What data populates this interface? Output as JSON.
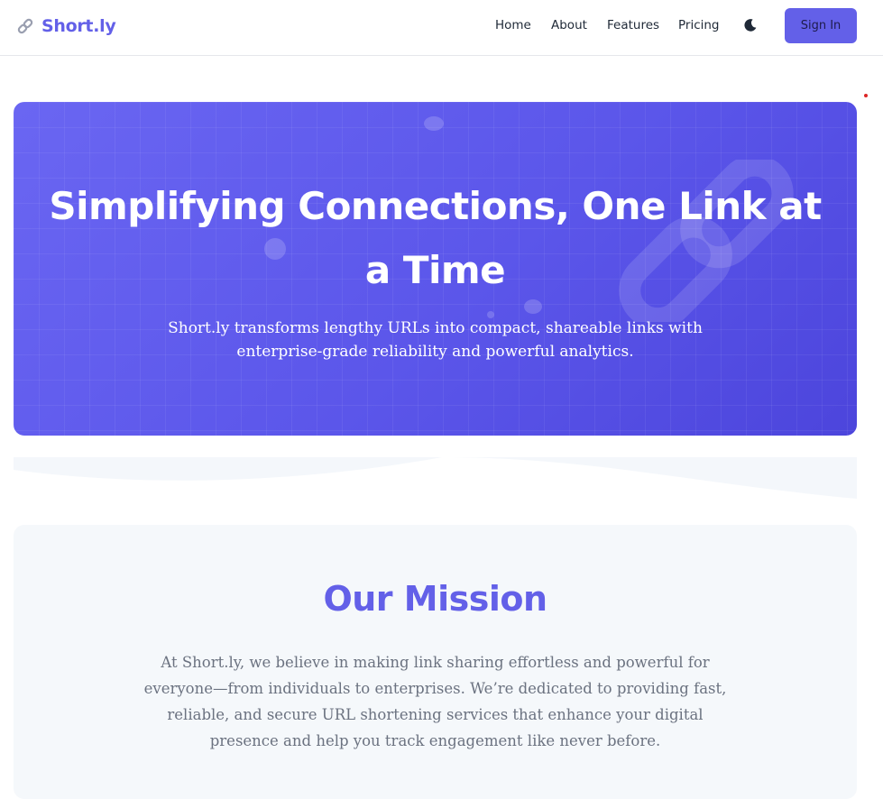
{
  "header": {
    "brand": {
      "icon": "link-icon",
      "name": "Short.ly"
    },
    "nav": [
      {
        "label": "Home"
      },
      {
        "label": "About"
      },
      {
        "label": "Features"
      },
      {
        "label": "Pricing"
      }
    ],
    "theme_toggle_icon": "moon-icon",
    "signin_label": "Sign In"
  },
  "hero": {
    "title": "Simplifying Connections, One Link at a Time",
    "subtitle": "Short.ly transforms lengthy URLs into compact, shareable links with enterprise-grade reliability and powerful analytics.",
    "decoration_icon": "chain-link-icon"
  },
  "mission": {
    "title": "Our Mission",
    "text": "At Short.ly, we believe in making link sharing effortless and powerful for everyone—from individuals to enterprises. We’re dedicated to providing fast, reliable, and secure URL shortening services that enhance your digital presence and help you track engagement like never before."
  },
  "colors": {
    "accent": "#6360e8",
    "hero_gradient_start": "#6a66f2",
    "hero_gradient_end": "#4c45dc",
    "mission_background": "#f5f8fb",
    "body_text_muted": "#6b7280"
  }
}
